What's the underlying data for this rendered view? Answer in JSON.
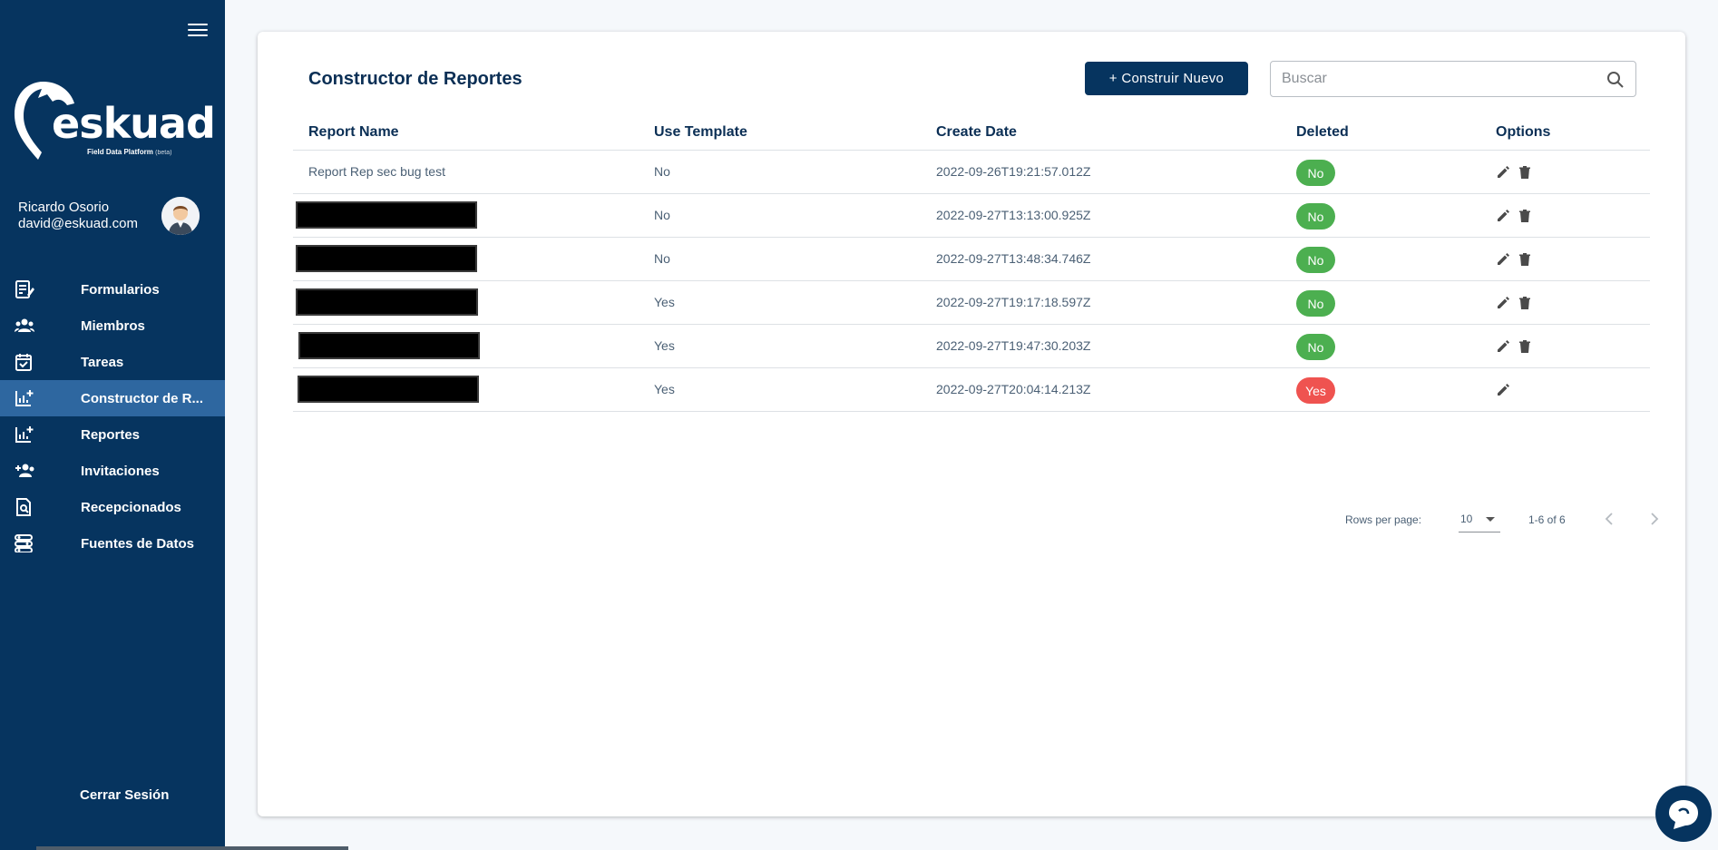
{
  "sidebar": {
    "logo_text": "eskuad",
    "logo_subtitle": "Field Data Platform",
    "logo_beta": "(beta)",
    "user_name": "Ricardo Osorio",
    "user_email": "david@eskuad.com",
    "items": [
      {
        "label": "Formularios",
        "icon": "form-icon"
      },
      {
        "label": "Miembros",
        "icon": "members-icon"
      },
      {
        "label": "Tareas",
        "icon": "calendar-check-icon"
      },
      {
        "label": "Constructor de R...",
        "icon": "chart-add-icon",
        "active": true
      },
      {
        "label": "Reportes",
        "icon": "chart-add-icon"
      },
      {
        "label": "Invitaciones",
        "icon": "person-add-icon"
      },
      {
        "label": "Recepcionados",
        "icon": "search-document-icon"
      },
      {
        "label": "Fuentes de Datos",
        "icon": "data-sources-icon"
      }
    ],
    "logout_label": "Cerrar Sesión"
  },
  "main": {
    "title": "Constructor de Reportes",
    "new_button_label": "+ Construir Nuevo",
    "search_placeholder": "Buscar",
    "columns": [
      "Report Name",
      "Use Template",
      "Create Date",
      "Deleted",
      "Options"
    ],
    "rows": [
      {
        "name": "Report Rep sec bug test",
        "redacted": false,
        "use_template": "No",
        "create_date": "2022-09-26T19:21:57.012Z",
        "deleted": "No",
        "can_delete": true
      },
      {
        "name": "",
        "redacted": true,
        "use_template": "No",
        "create_date": "2022-09-27T13:13:00.925Z",
        "deleted": "No",
        "can_delete": true
      },
      {
        "name": "",
        "redacted": true,
        "use_template": "No",
        "create_date": "2022-09-27T13:48:34.746Z",
        "deleted": "No",
        "can_delete": true
      },
      {
        "name": "",
        "redacted": true,
        "use_template": "Yes",
        "create_date": "2022-09-27T19:17:18.597Z",
        "deleted": "No",
        "can_delete": true
      },
      {
        "name": "",
        "redacted": true,
        "use_template": "Yes",
        "create_date": "2022-09-27T19:47:30.203Z",
        "deleted": "No",
        "can_delete": true
      },
      {
        "name": "",
        "redacted": true,
        "use_template": "Yes",
        "create_date": "2022-09-27T20:04:14.213Z",
        "deleted": "Yes",
        "can_delete": false
      }
    ],
    "pagination": {
      "rows_per_page_label": "Rows per page:",
      "rows_per_page_value": "10",
      "range_label": "1-6 of 6"
    }
  },
  "colors": {
    "sidebar_bg": "#06345f",
    "active_item_bg": "#2e67a0",
    "badge_no": "#4caf50",
    "badge_yes": "#ef5350"
  }
}
